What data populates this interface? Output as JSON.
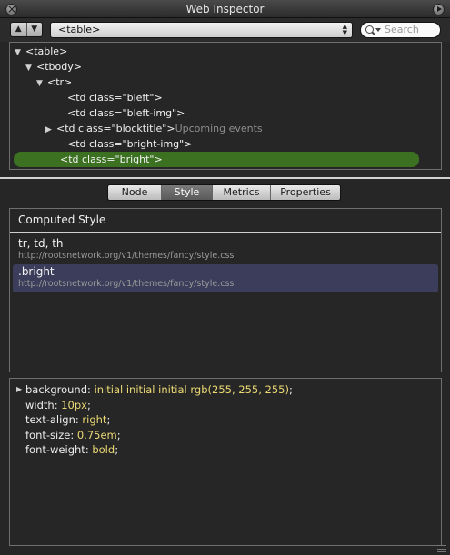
{
  "window": {
    "title": "Web Inspector"
  },
  "toolbar": {
    "back_arrow": "▲",
    "forward_arrow": "▼",
    "breadcrumb": "<table>",
    "search_placeholder": "Search"
  },
  "dom_tree": [
    {
      "disclosure": "▼",
      "tag": "<table>",
      "note": "",
      "depth": 0,
      "selected": false
    },
    {
      "disclosure": "▼",
      "tag": "<tbody>",
      "note": "",
      "depth": 1,
      "selected": false
    },
    {
      "disclosure": "▼",
      "tag": "<tr>",
      "note": "",
      "depth": 2,
      "selected": false
    },
    {
      "disclosure": "",
      "tag": "<td class=\"bleft\">",
      "note": "",
      "depth": 3,
      "selected": false
    },
    {
      "disclosure": "",
      "tag": "<td class=\"bleft-img\">",
      "note": "",
      "depth": 3,
      "selected": false
    },
    {
      "disclosure": "▶",
      "tag": "<td class=\"blocktitle\">",
      "note": "Upcoming events",
      "depth": 3,
      "selected": false
    },
    {
      "disclosure": "",
      "tag": "<td class=\"bright-img\">",
      "note": "",
      "depth": 3,
      "selected": false
    },
    {
      "disclosure": "",
      "tag": "<td class=\"bright\">",
      "note": "",
      "depth": 3,
      "selected": true
    }
  ],
  "tabs": [
    {
      "label": "Node",
      "active": false
    },
    {
      "label": "Style",
      "active": true
    },
    {
      "label": "Metrics",
      "active": false
    },
    {
      "label": "Properties",
      "active": false
    }
  ],
  "style_panel": {
    "computed_label": "Computed Style",
    "rules": [
      {
        "selector": "tr, td, th",
        "source": "http://rootsnetwork.org/v1/themes/fancy/style.css",
        "selected": false
      },
      {
        "selector": ".bright",
        "source": "http://rootsnetwork.org/v1/themes/fancy/style.css",
        "selected": true
      }
    ]
  },
  "properties": [
    {
      "name": "background",
      "value": "initial initial initial rgb(255, 255, 255)",
      "expandable": true
    },
    {
      "name": "width",
      "value": "10px",
      "expandable": false
    },
    {
      "name": "text-align",
      "value": "right",
      "expandable": false
    },
    {
      "name": "font-size",
      "value": "0.75em",
      "expandable": false
    },
    {
      "name": "font-weight",
      "value": "bold",
      "expandable": false
    }
  ],
  "colors": {
    "selected_node": "#3b7121",
    "selected_rule": "#3c3d5b",
    "property_value": "#ecd974"
  }
}
